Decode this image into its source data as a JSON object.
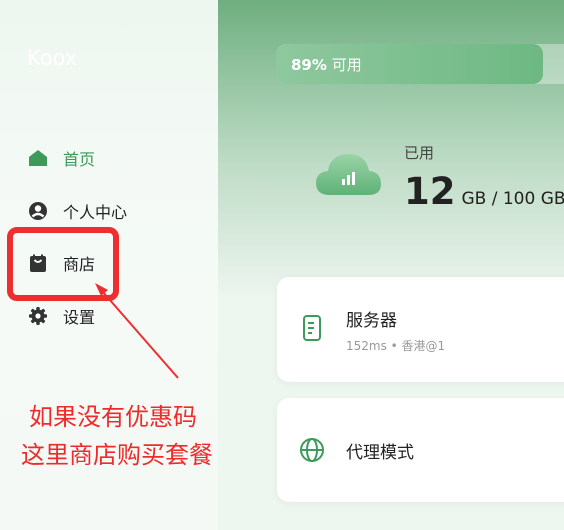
{
  "app": {
    "title": "Koox"
  },
  "sidebar": {
    "items": [
      {
        "label": "首页",
        "icon": "home-icon",
        "active": true
      },
      {
        "label": "个人中心",
        "icon": "user-icon",
        "active": false
      },
      {
        "label": "商店",
        "icon": "shop-bag-icon",
        "active": false
      },
      {
        "label": "设置",
        "icon": "gear-icon",
        "active": false
      }
    ]
  },
  "usage": {
    "percent_text": "89%",
    "percent_value": 89,
    "suffix": "可用"
  },
  "storage": {
    "label": "已用",
    "used": "12",
    "unit_total": "GB / 100 GB",
    "icon": "cloud-chart-icon"
  },
  "cards": {
    "server": {
      "title": "服务器",
      "subtitle": "152ms • 香港@1",
      "icon": "server-icon"
    },
    "proxy": {
      "title": "代理模式",
      "icon": "globe-icon"
    }
  },
  "annotation": {
    "line1": "如果没有优惠码",
    "line2": "这里商店购买套餐"
  },
  "colors": {
    "accent": "#3d9a5a",
    "annotation_red": "#ef2f2f",
    "header_green": "#6fae7f"
  }
}
